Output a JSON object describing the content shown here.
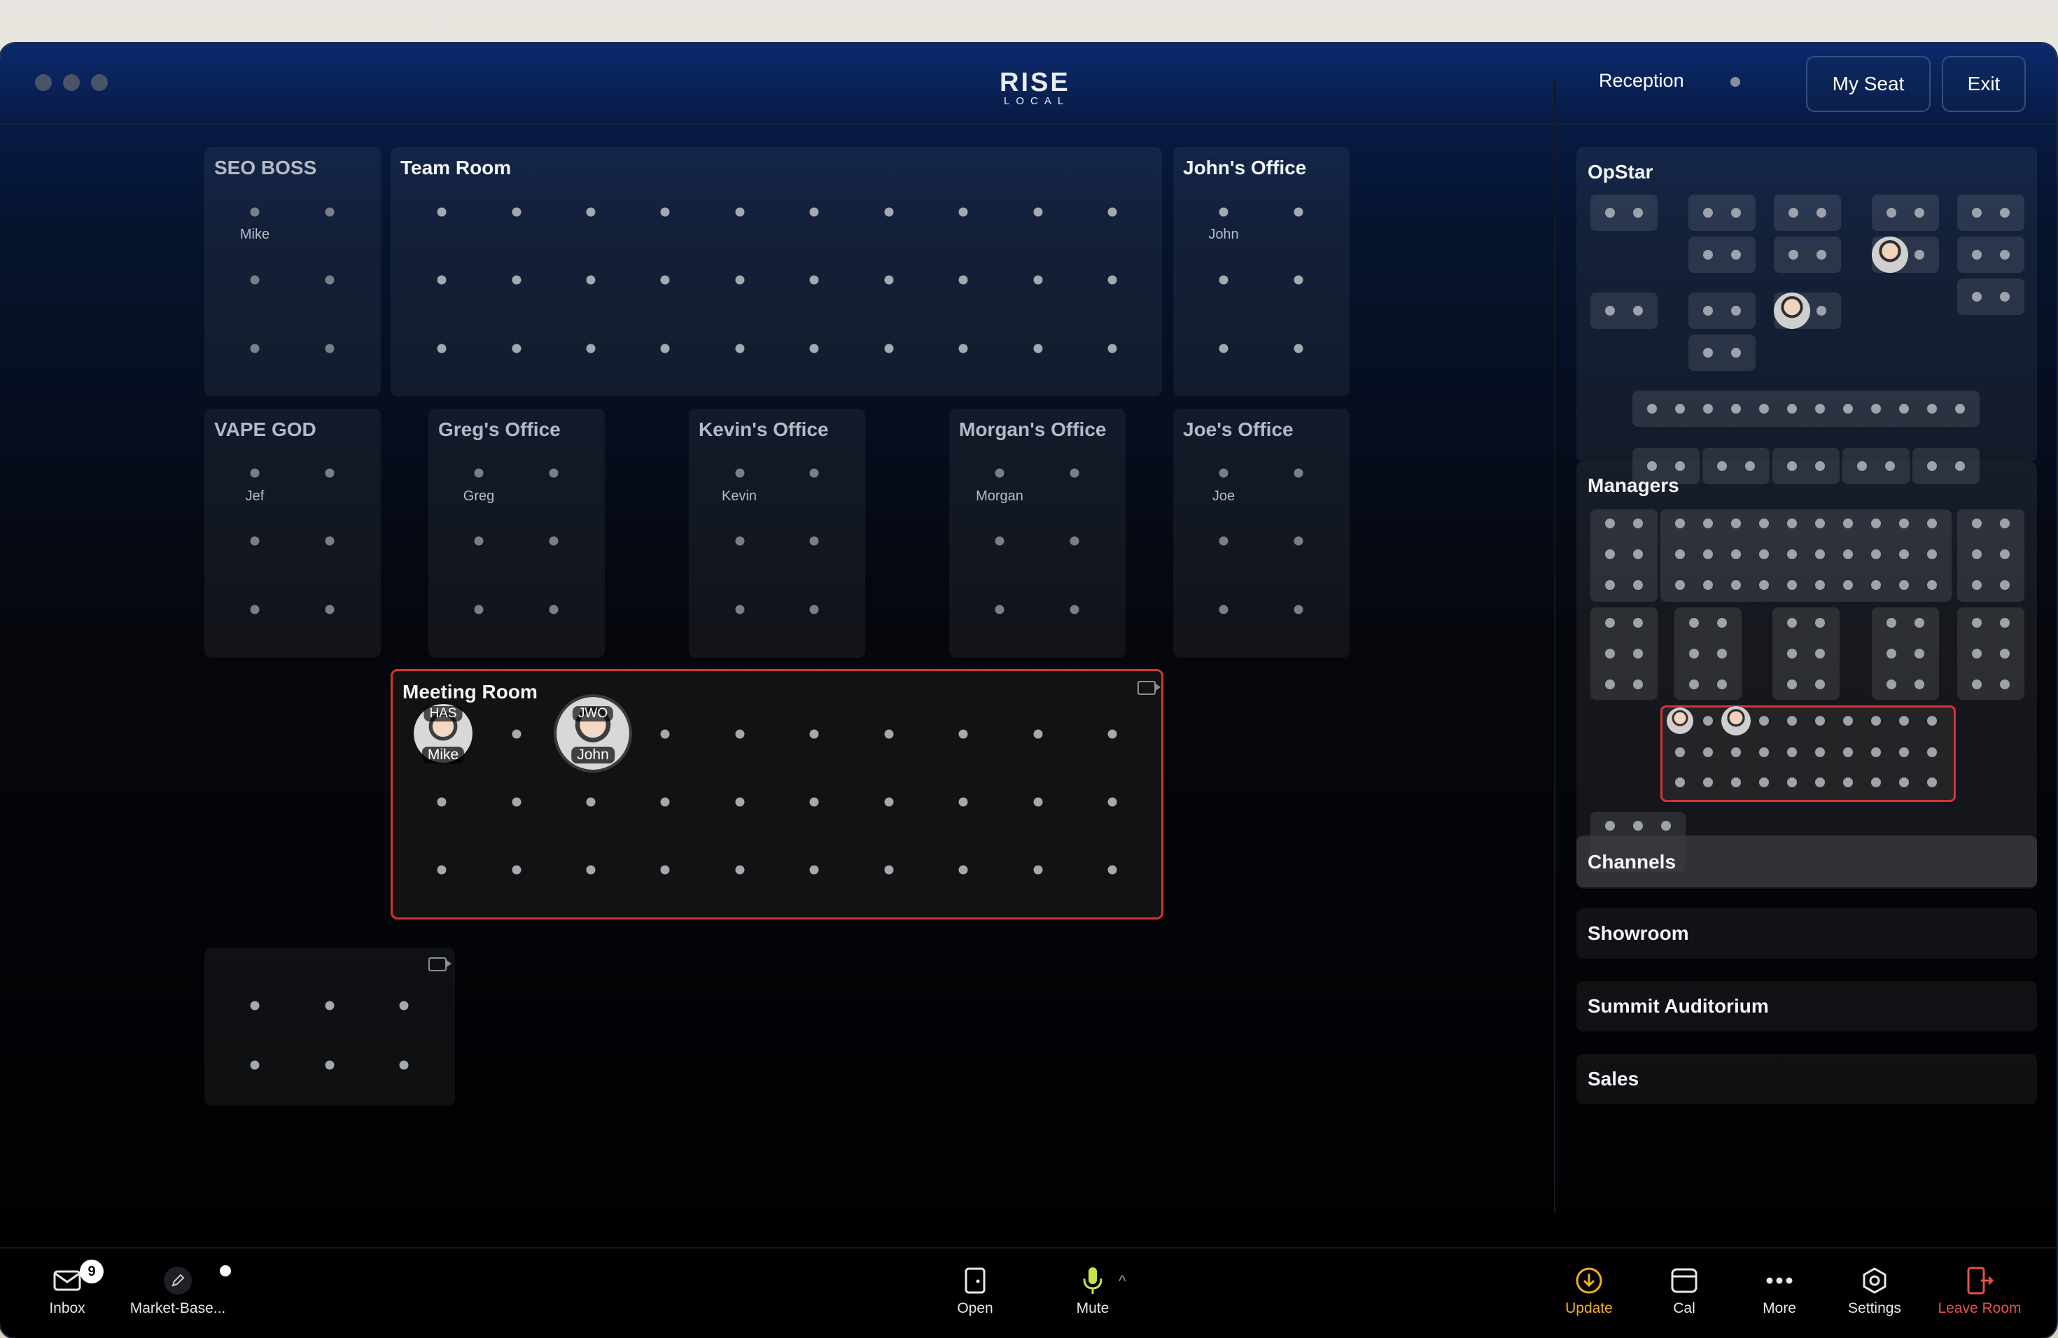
{
  "app": {
    "logo_top": "RISE",
    "logo_bottom": "LOCAL"
  },
  "header": {
    "location": "Reception",
    "my_seat": "My Seat",
    "exit": "Exit"
  },
  "rooms": {
    "seo_boss": {
      "name": "SEO BOSS",
      "seat": "Mike"
    },
    "team_room": {
      "name": "Team Room"
    },
    "johns_office": {
      "name": "John's Office",
      "seat": "John"
    },
    "vape_god": {
      "name": "VAPE GOD",
      "seat": "Jef"
    },
    "gregs_office": {
      "name": "Greg's Office",
      "seat": "Greg"
    },
    "kevins_office": {
      "name": "Kevin's Office",
      "seat": "Kevin"
    },
    "morgans_office": {
      "name": "Morgan's Office",
      "seat": "Morgan"
    },
    "joes_office": {
      "name": "Joe's Office",
      "seat": "Joe"
    },
    "meeting_room": {
      "name": "Meeting Room",
      "participants": [
        {
          "initials": "HAS",
          "name": "Mike"
        },
        {
          "initials": "JWO",
          "name": "John"
        }
      ]
    }
  },
  "sidebar": {
    "opstar": "OpStar",
    "managers": "Managers",
    "channels": "Channels",
    "showroom": "Showroom",
    "summit": "Summit Auditorium",
    "sales": "Sales"
  },
  "bottombar": {
    "inbox": "Inbox",
    "inbox_badge": "9",
    "market": "Market-Base...",
    "open": "Open",
    "mute": "Mute",
    "update": "Update",
    "cal": "Cal",
    "more": "More",
    "settings": "Settings",
    "leave": "Leave Room"
  },
  "colors": {
    "accent_red": "#d23434",
    "update_yellow": "#f2b01e",
    "mic_green": "#c6e24a",
    "leave_red": "#e2524b"
  }
}
